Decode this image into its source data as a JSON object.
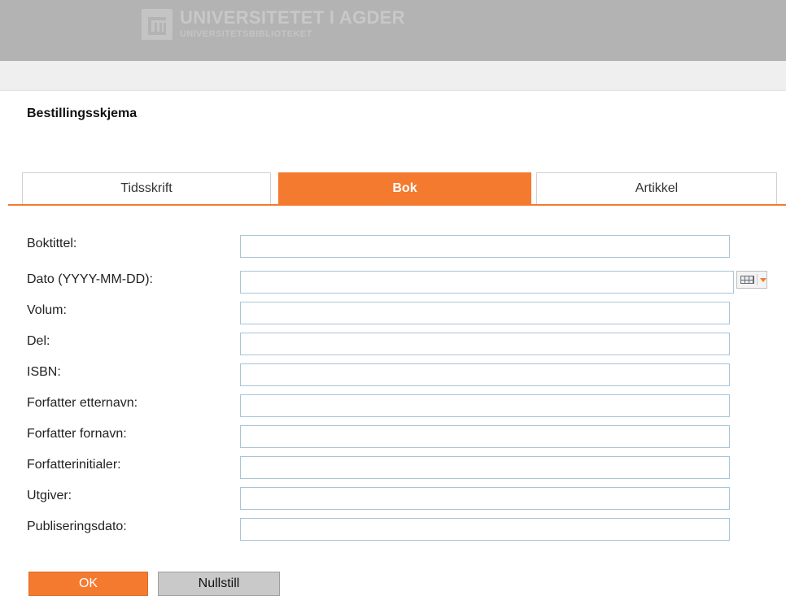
{
  "header": {
    "logo_name": "UNIVERSITETET I AGDER",
    "logo_sub": "UNIVERSITETSBIBLIOTEKET"
  },
  "page": {
    "title": "Bestillingsskjema"
  },
  "tabs": [
    {
      "label": "Tidsskrift",
      "active": false
    },
    {
      "label": "Bok",
      "active": true
    },
    {
      "label": "Artikkel",
      "active": false
    }
  ],
  "form": {
    "fields": [
      {
        "label": "Boktittel:",
        "value": ""
      },
      {
        "label": "Dato (YYYY-MM-DD):",
        "value": ""
      },
      {
        "label": "Volum:",
        "value": ""
      },
      {
        "label": "Del:",
        "value": ""
      },
      {
        "label": "ISBN:",
        "value": ""
      },
      {
        "label": "Forfatter etternavn:",
        "value": ""
      },
      {
        "label": "Forfatter fornavn:",
        "value": ""
      },
      {
        "label": "Forfatterinitialer:",
        "value": ""
      },
      {
        "label": "Utgiver:",
        "value": ""
      },
      {
        "label": "Publiseringsdato:",
        "value": ""
      }
    ],
    "calendar_icon": "calendar-icon"
  },
  "buttons": {
    "ok": "OK",
    "reset": "Nullstill"
  },
  "colors": {
    "accent": "#f47a30",
    "header_bg": "#b3b3b3",
    "input_border": "#a8c4d8"
  }
}
